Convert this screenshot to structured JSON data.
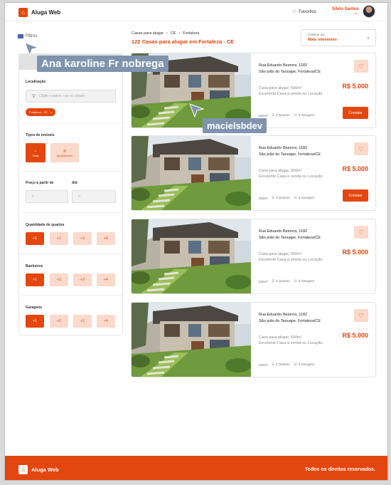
{
  "brand": {
    "name": "Aluga Web",
    "accent": "#e4460f"
  },
  "header": {
    "favorites_label": "Favoritos",
    "user_name": "Silvio Santos",
    "user_role": "Dan"
  },
  "filters": {
    "title": "Filtros",
    "location_label": "Localização",
    "location_placeholder": "Digite o bairro, rua ou cidade",
    "location_tag": "Fortaleza - CE",
    "types_label": "Tipos de imóveis",
    "types": [
      {
        "label": "Casa",
        "icon": "house-icon",
        "active": true
      },
      {
        "label": "Apartamento",
        "icon": "building-icon",
        "active": false
      }
    ],
    "price_from_label": "Preço à partir de",
    "price_to_label": "Até",
    "price_from_value": "0",
    "price_to_value": "0",
    "rooms_label": "Quantidade de quartos",
    "baths_label": "Banheiros",
    "garages_label": "Garagens",
    "options": [
      "+1",
      "+2",
      "+3",
      "+4"
    ]
  },
  "breadcrumb": {
    "items": [
      "Casas para alugar",
      "CE",
      "Fortaleza"
    ]
  },
  "results_title": "122 Casas para alugar em Fortaleza - CE",
  "sort": {
    "label": "Ordenar por",
    "value": "Mais relevantes"
  },
  "listings": [
    {
      "address1": "Rua Eduardo Bezerra, 1182",
      "address2": "São joão do Taouape, Fortaleza/CE",
      "desc1": "Casa para alugar, 500m²",
      "desc2": "Excelente Casa à venda ou Locação",
      "price": "R$ 5.000",
      "area": "500m²",
      "rooms": "3 Quartos",
      "garage": "5 Garagem",
      "contact": "Contatar"
    },
    {
      "address1": "Rua Eduardo Bezerra, 1182",
      "address2": "São joão do Taouape, Fortaleza/CE",
      "desc1": "Casa para alugar, 500m²",
      "desc2": "Excelente Casa à venda ou Locação",
      "price": "R$ 5.000",
      "area": "500m²",
      "rooms": "3 Quartos",
      "garage": "5 Garagem",
      "contact": "Contatar"
    },
    {
      "address1": "Rua Eduardo Bezerra, 1182",
      "address2": "São joão do Taouape, Fortaleza/CE",
      "desc1": "Casa para alugar, 500m²",
      "desc2": "Excelente Casa à venda ou Locação",
      "price": "R$ 5.000",
      "area": "500m²",
      "rooms": "3 Quartos",
      "garage": "5 Garagem",
      "contact": ""
    },
    {
      "address1": "Rua Eduardo Bezerra, 1182",
      "address2": "São joão do Taouape, Fortaleza/CE",
      "desc1": "Casa para alugar, 500m²",
      "desc2": "Excelente Casa à venda ou Locação",
      "price": "R$ 5.000",
      "area": "500m²",
      "rooms": "3 Quartos",
      "garage": "5 Garagem",
      "contact": ""
    }
  ],
  "footer": {
    "brand": "Aluga Web",
    "rights": "Todos os direitos reservados."
  },
  "collaborators": [
    {
      "name": "Ana karoline Fr nobrega"
    },
    {
      "name": "macielsbdev"
    }
  ]
}
